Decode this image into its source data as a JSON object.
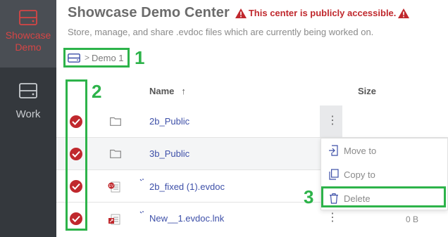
{
  "sidebar": {
    "items": [
      {
        "label": "Showcase Demo",
        "icon": "drive-icon",
        "active": true
      },
      {
        "label": "Work",
        "icon": "drive-icon",
        "active": false
      }
    ]
  },
  "header": {
    "title": "Showcase Demo Center",
    "warning": "This center is publicly accessible.",
    "subtitle": "Store, manage, and share .evdoc files which are currently being worked on."
  },
  "breadcrumb": {
    "root_icon": "drive-icon",
    "separator": ">",
    "current": "Demo 1"
  },
  "callouts": [
    "1",
    "2",
    "3"
  ],
  "table": {
    "columns": {
      "name": "Name",
      "sort_arrow": "↑",
      "size": "Size"
    },
    "rows": [
      {
        "name": "2b_Public",
        "type": "folder",
        "size": "",
        "checked": true
      },
      {
        "name": "3b_Public",
        "type": "folder",
        "size": "",
        "checked": true
      },
      {
        "name": "2b_fixed (1).evdoc",
        "type": "evdoc",
        "size": "",
        "checked": true
      },
      {
        "name": "New__1.evdoc.lnk",
        "type": "evdoc-link",
        "size": "0 B",
        "checked": true
      }
    ]
  },
  "context_menu": {
    "items": [
      {
        "label": "Move to",
        "icon": "move-icon"
      },
      {
        "label": "Copy to",
        "icon": "copy-icon"
      },
      {
        "label": "Delete",
        "icon": "trash-icon"
      }
    ]
  },
  "colors": {
    "sidebar_bg": "#34383d",
    "accent_red": "#c0282d",
    "link_blue": "#3d4fa8",
    "callout_green": "#2db34a"
  }
}
